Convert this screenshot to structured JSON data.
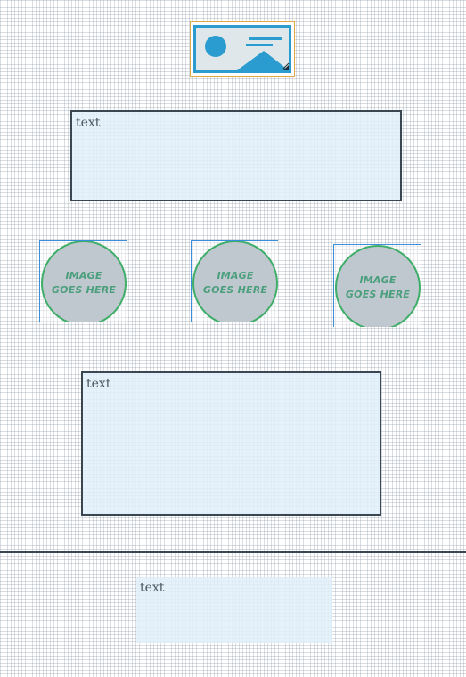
{
  "image_widget": {
    "icon": "image-icon"
  },
  "textboxes": [
    {
      "text": "text"
    },
    {
      "text": "text"
    },
    {
      "text": "text"
    }
  ],
  "placeholders": [
    {
      "line1": "IMAGE",
      "line2": "GOES HERE"
    },
    {
      "line1": "IMAGE",
      "line2": "GOES HERE"
    },
    {
      "line1": "IMAGE",
      "line2": "GOES HERE"
    }
  ],
  "colors": {
    "image_icon_blue": "#2b9ccf",
    "image_widget_border": "#e0a94a",
    "circle_border": "#3fae69",
    "circle_fill": "#bfc7cf",
    "placeholder_text": "#4b9f7d",
    "textbox_fill": "#e1f0fa",
    "frame_border": "#3a4652"
  }
}
